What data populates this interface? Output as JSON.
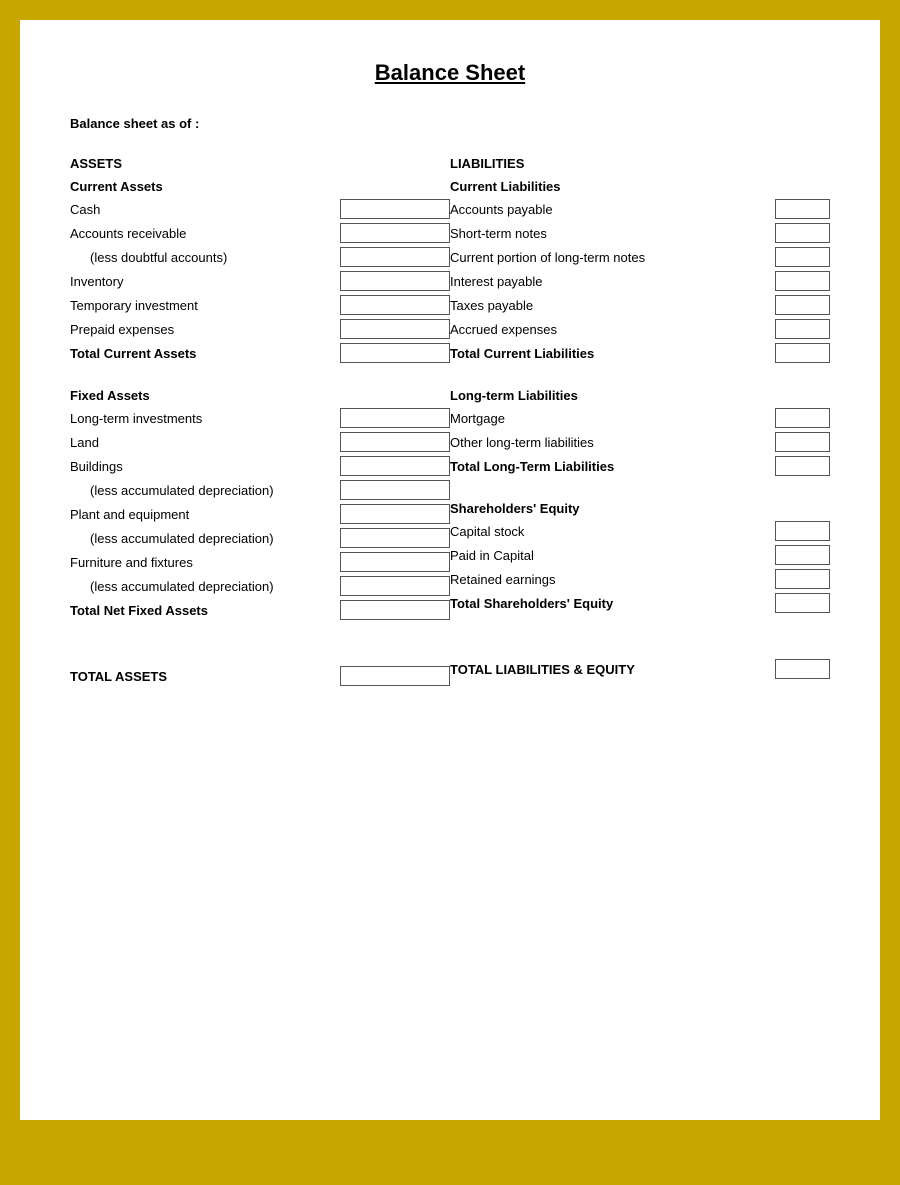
{
  "title": "Balance Sheet",
  "as_of_label": "Balance sheet as of :",
  "assets": {
    "header": "ASSETS",
    "current_assets": {
      "header": "Current Assets",
      "items": [
        {
          "label": "Cash",
          "indent": false
        },
        {
          "label": "Accounts receivable",
          "indent": false
        },
        {
          "label": "(less doubtful accounts)",
          "indent": true
        },
        {
          "label": "Inventory",
          "indent": false
        },
        {
          "label": "Temporary investment",
          "indent": false
        },
        {
          "label": "Prepaid expenses",
          "indent": false
        }
      ],
      "total_label": "Total Current Assets"
    },
    "fixed_assets": {
      "header": "Fixed Assets",
      "items": [
        {
          "label": "Long-term investments",
          "indent": false
        },
        {
          "label": "Land",
          "indent": false
        },
        {
          "label": "Buildings",
          "indent": false
        },
        {
          "label": "(less accumulated depreciation)",
          "indent": true
        },
        {
          "label": "Plant and equipment",
          "indent": false
        },
        {
          "label": "(less accumulated depreciation)",
          "indent": true
        },
        {
          "label": "Furniture and fixtures",
          "indent": false
        },
        {
          "label": "(less accumulated depreciation)",
          "indent": true
        }
      ],
      "total_label": "Total Net Fixed Assets"
    },
    "total_label": "TOTAL ASSETS"
  },
  "liabilities": {
    "header": "LIABILITIES",
    "current_liabilities": {
      "header": "Current Liabilities",
      "items": [
        {
          "label": "Accounts payable"
        },
        {
          "label": "Short-term notes"
        },
        {
          "label": "Current portion of long-term notes"
        },
        {
          "label": "Interest payable"
        },
        {
          "label": "Taxes payable"
        },
        {
          "label": "Accrued expenses"
        }
      ],
      "total_label": "Total Current Liabilities"
    },
    "longterm_liabilities": {
      "header": "Long-term Liabilities",
      "items": [
        {
          "label": "Mortgage"
        },
        {
          "label": "Other long-term liabilities"
        }
      ],
      "total_label": "Total Long-Term Liabilities"
    },
    "equity": {
      "header": "Shareholders' Equity",
      "items": [
        {
          "label": "Capital stock"
        },
        {
          "label": "Paid in Capital"
        },
        {
          "label": "Retained earnings"
        }
      ],
      "total_label": "Total Shareholders' Equity"
    },
    "total_label": "TOTAL LIABILITIES & EQUITY"
  }
}
